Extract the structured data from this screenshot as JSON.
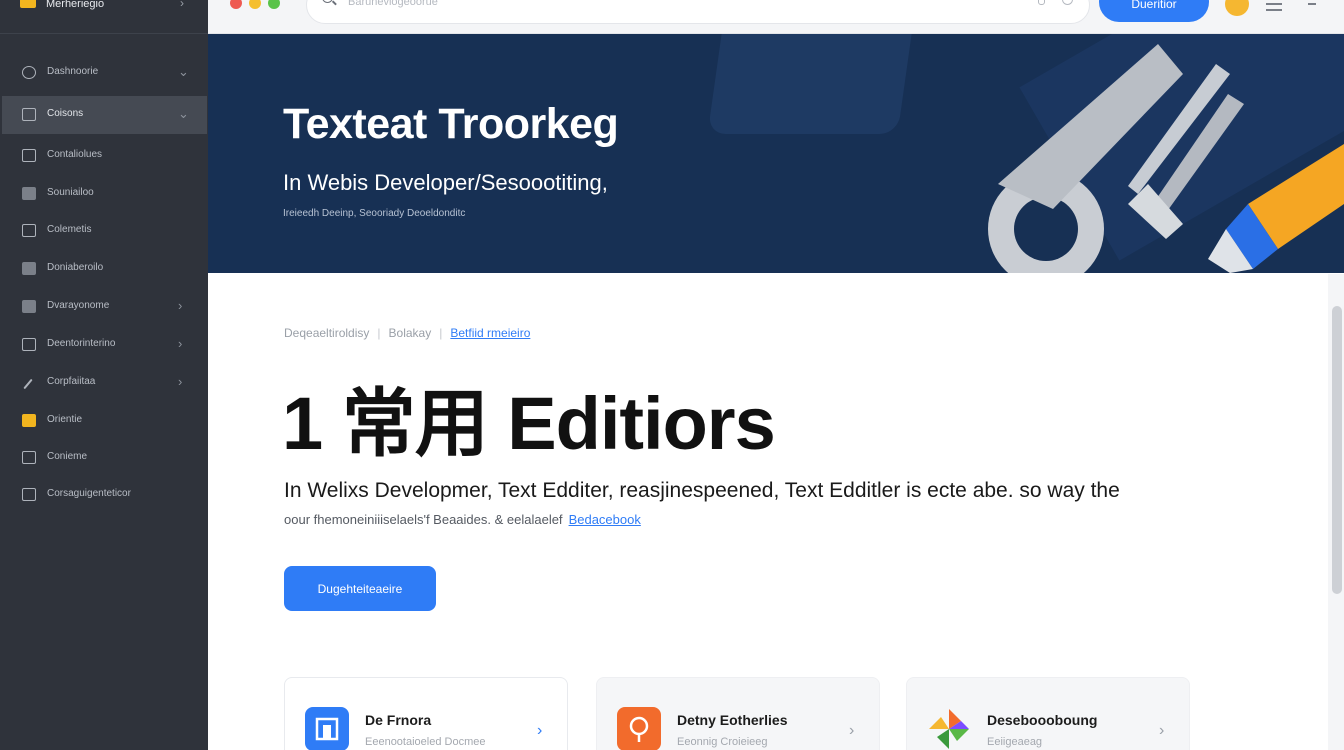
{
  "sidebar": {
    "app_title": "Merheriegio",
    "items": [
      {
        "label": "Dashnoorie",
        "icon": "chat-bubble-icon",
        "chevron": "⌄"
      },
      {
        "label": "Coisons",
        "icon": "database-icon",
        "chevron": "⌄",
        "active": true
      },
      {
        "label": "Contaliolues",
        "icon": "card-icon"
      },
      {
        "label": "Souniailoo",
        "icon": "puzzle-icon"
      },
      {
        "label": "Colemetis",
        "icon": "document-icon"
      },
      {
        "label": "Doniaberoilo",
        "icon": "folder-icon"
      },
      {
        "label": "Dvarayonome",
        "icon": "edit-icon",
        "chevron": "›"
      },
      {
        "label": "Deentorinterino",
        "icon": "play-box-icon",
        "chevron": "›"
      },
      {
        "label": "Corpfaiitaa",
        "icon": "pen-icon",
        "chevron": "›"
      },
      {
        "label": "Orientie",
        "icon": "window-icon"
      },
      {
        "label": "Conieme",
        "icon": "image-icon"
      },
      {
        "label": "Corsaguigenteticor",
        "icon": "grid-icon"
      }
    ]
  },
  "topbar": {
    "search_placeholder": "Baruheviogeoorue",
    "cta_label": "Dueritior"
  },
  "hero": {
    "title": "Texteat Troorkeg",
    "subtitle": "In Webis Developer/Sesoootiting,",
    "small": "Ireieedh Deeinp, Seooriady Deoeldonditc"
  },
  "main": {
    "breadcrumb": [
      "Deqeaeltiroldisy",
      "Bolakay",
      "Betfiid rmeieiro"
    ],
    "title": "1 常用 Editiors",
    "intro_line1": "In Welixs Developmer, Text Edditer, reasjinespeened, Text Edditler is ecte abe. so way the",
    "intro_line2": "oour fhemoneiniiiselaels'f Beaaides. & eelalaelef",
    "intro_link": "Bedacebook",
    "button_label": "Dugehteiteaeire"
  },
  "cards": [
    {
      "title": "De Frnora",
      "subtitle": "Eeenootaioeled Docmee",
      "icon_color": "#2f7cf6",
      "icon": "layout-icon"
    },
    {
      "title": "Detny Eotherlies",
      "subtitle": "Eeonnig Croieieeg",
      "icon_color": "#f26b2c",
      "icon": "pin-icon"
    },
    {
      "title": "Deseboooboung",
      "subtitle": "Eeiigeaeag",
      "icon_color": "#5ab847",
      "icon": "pinwheel-icon"
    }
  ],
  "colors": {
    "accent": "#2f7cf6",
    "sidebar_bg": "#2f333b",
    "hero_bg": "#173054"
  }
}
